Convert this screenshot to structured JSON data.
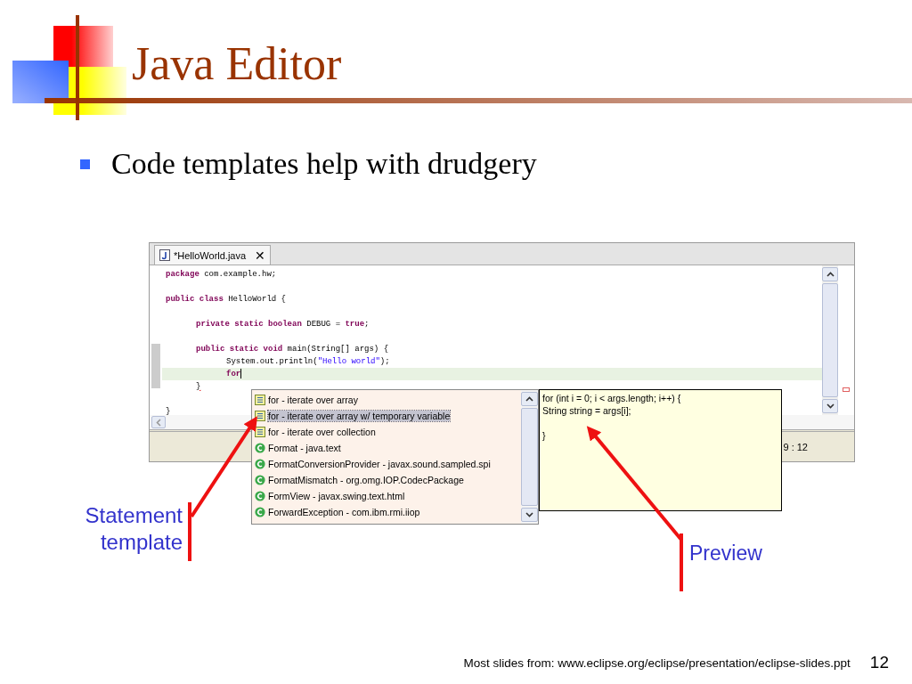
{
  "slide": {
    "title": "Java Editor",
    "bullet": "Code templates help with drudgery"
  },
  "editor": {
    "tab": {
      "label": "*HelloWorld.java",
      "close": "✕",
      "selected": true
    },
    "lines": [
      {
        "spaced": false,
        "current": false,
        "segments": [
          {
            "kind": "keyword",
            "text": "package"
          },
          {
            "kind": "plain",
            "text": " com.example.hw;"
          }
        ]
      },
      {
        "spaced": true,
        "current": false,
        "segments": [
          {
            "kind": "keyword",
            "text": "public class"
          },
          {
            "kind": "plain",
            "text": " HelloWorld {"
          }
        ],
        "children": [
          {
            "spaced": true,
            "current": false,
            "segments": [
              {
                "kind": "keyword",
                "text": "private static boolean"
              },
              {
                "kind": "plain",
                "text": " DEBUG = "
              },
              {
                "kind": "keyword",
                "text": "true"
              },
              {
                "kind": "plain",
                "text": ";"
              }
            ]
          },
          {
            "spaced": true,
            "current": false,
            "segments": [
              {
                "kind": "keyword",
                "text": "public static void"
              },
              {
                "kind": "plain",
                "text": " main(String[] args) {"
              }
            ],
            "children": [
              {
                "spaced": false,
                "current": false,
                "segments": [
                  {
                    "kind": "plain",
                    "text": "System.out.println("
                  },
                  {
                    "kind": "string",
                    "text": "\"Hello world\""
                  },
                  {
                    "kind": "plain",
                    "text": ");"
                  }
                ]
              },
              {
                "spaced": false,
                "current": true,
                "segments": [
                  {
                    "kind": "keyword",
                    "text": "for"
                  }
                ]
              }
            ]
          },
          {
            "spaced": false,
            "current": false,
            "segments": [
              {
                "kind": "error",
                "text": "}"
              }
            ]
          }
        ]
      },
      {
        "spaced": true,
        "current": false,
        "segments": [
          {
            "kind": "plain",
            "text": "}"
          }
        ]
      }
    ],
    "status": "9 : 12"
  },
  "completion": {
    "items": [
      {
        "kind": "template",
        "label": "for - iterate over array",
        "selected": false
      },
      {
        "kind": "template",
        "label": "for - iterate over array w/ temporary variable",
        "selected": true
      },
      {
        "kind": "template",
        "label": "for - iterate over collection",
        "selected": false
      },
      {
        "kind": "class",
        "label": "Format - java.text",
        "selected": false
      },
      {
        "kind": "class",
        "label": "FormatConversionProvider - javax.sound.sampled.spi",
        "selected": false
      },
      {
        "kind": "class",
        "label": "FormatMismatch - org.omg.IOP.CodecPackage",
        "selected": false
      },
      {
        "kind": "class",
        "label": "FormView - javax.swing.text.html",
        "selected": false
      },
      {
        "kind": "class",
        "label": "ForwardException - com.ibm.rmi.iiop",
        "selected": false
      }
    ]
  },
  "preview": {
    "text": "for (int i = 0; i < args.length; i++) {\nString string = args[i];\n\n}"
  },
  "callouts": [
    {
      "kind": "left",
      "text": "Statement template"
    },
    {
      "kind": "right",
      "text": "Preview"
    }
  ],
  "footer": {
    "source": "Most slides from: www.eclipse.org/eclipse/presentation/eclipse-slides.ppt",
    "page": "12"
  }
}
